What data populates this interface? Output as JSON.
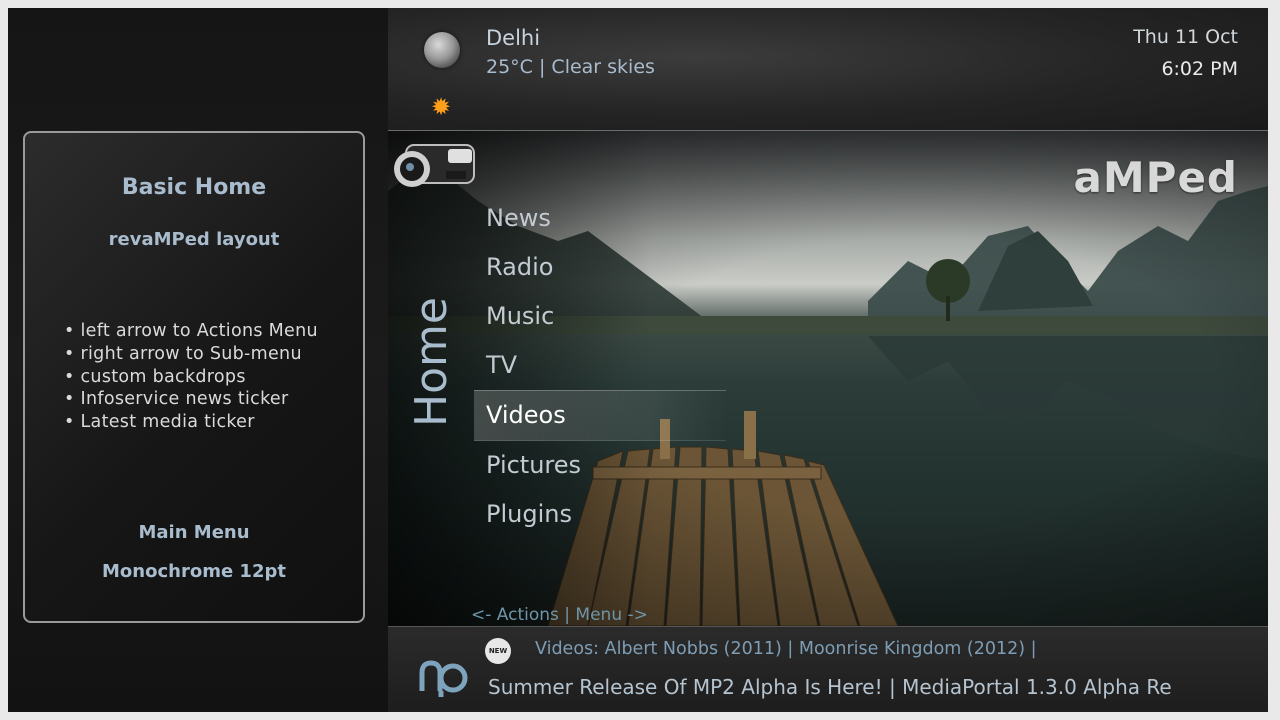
{
  "info_panel": {
    "title": "Basic Home",
    "subtitle": "revaMPed layout",
    "bullets": [
      "left arrow to Actions Menu",
      "right arrow to Sub-menu",
      "custom backdrops",
      "Infoservice news ticker",
      "Latest media ticker"
    ],
    "section": "Main Menu",
    "theme": "Monochrome 12pt"
  },
  "weather": {
    "city": "Delhi",
    "conditions": "25°C | Clear skies",
    "current_icon": "moon-icon",
    "forecast_icon": "sun-icon"
  },
  "clock": {
    "date": "Thu 11 Oct",
    "time": "6:02 PM"
  },
  "brand": {
    "logo_text": "aMPed"
  },
  "home_label": "Home",
  "menu": {
    "items": [
      "News",
      "Radio",
      "Music",
      "TV",
      "Videos",
      "Pictures",
      "Plugins"
    ],
    "selected": "Videos"
  },
  "hint": "<- Actions | Menu ->",
  "ticker": {
    "badge": "NEW",
    "media": "Videos: Albert Nobbs (2011) | Moonrise Kingdom (2012) |",
    "news": "Summer Release Of MP2 Alpha Is Here! | MediaPortal 1.3.0 Alpha Re"
  },
  "colors": {
    "accent": "#a9bccd",
    "hint": "#6e95a8",
    "sun": "#ff9e1a"
  }
}
